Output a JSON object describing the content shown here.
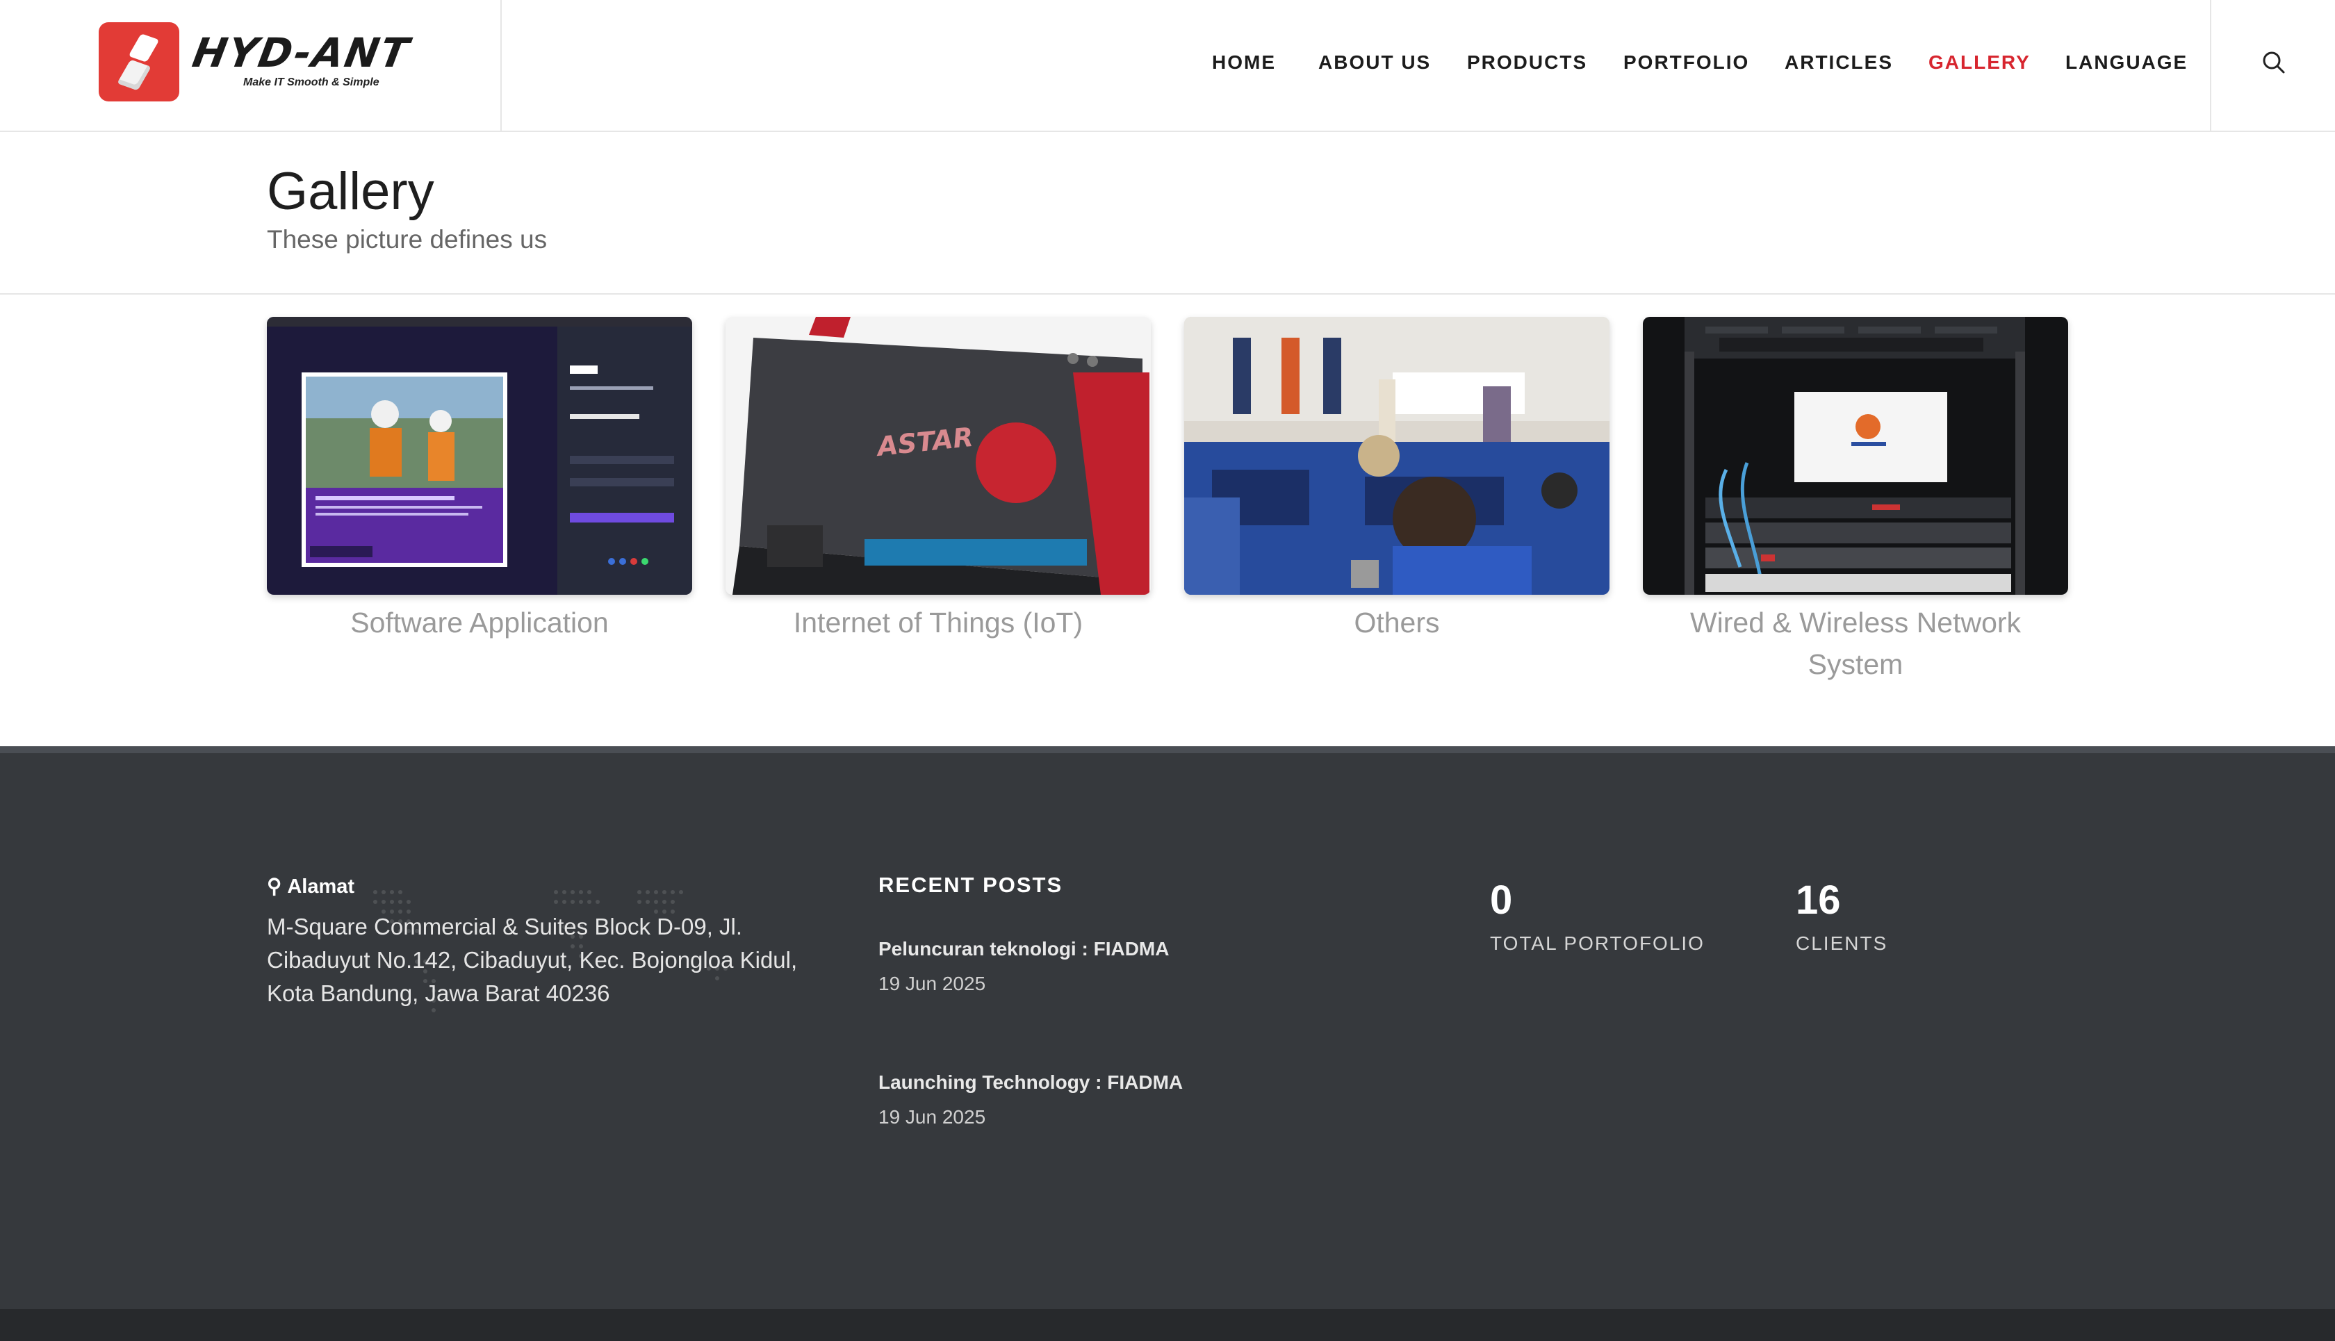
{
  "brand": {
    "name": "HYD-ANT",
    "tagline": "Make IT Smooth & Simple"
  },
  "nav": {
    "items": [
      {
        "label": "HOME"
      },
      {
        "label": "ABOUT US"
      },
      {
        "label": "PRODUCTS"
      },
      {
        "label": "PORTFOLIO"
      },
      {
        "label": "ARTICLES"
      },
      {
        "label": "GALLERY",
        "active": true
      },
      {
        "label": "LANGUAGE"
      }
    ],
    "active_color": "#d7262f",
    "search_icon": "search-icon"
  },
  "page": {
    "title": "Gallery",
    "subtitle": "These picture defines us"
  },
  "gallery": [
    {
      "caption": "Software Application"
    },
    {
      "caption": "Internet of Things (IoT)"
    },
    {
      "caption": "Others"
    },
    {
      "caption": "Wired & Wireless Network System"
    }
  ],
  "footer": {
    "address_label": "Alamat",
    "address": "M-Square Commercial & Suites Block D-09, Jl. Cibaduyut No.142, Cibaduyut, Kec. Bojongloa Kidul, Kota Bandung, Jawa Barat 40236",
    "recent_posts_heading": "RECENT POSTS",
    "posts": [
      {
        "title": "Peluncuran teknologi : FIADMA",
        "date": "19 Jun 2025"
      },
      {
        "title": "Launching Technology : FIADMA",
        "date": "19 Jun 2025"
      }
    ],
    "stats": [
      {
        "value": "0",
        "label": "TOTAL PORTOFOLIO"
      },
      {
        "value": "16",
        "label": "CLIENTS"
      }
    ]
  },
  "colors": {
    "accent": "#d7262f",
    "footer_bg": "#36393d",
    "logo_red": "#e23b36"
  }
}
